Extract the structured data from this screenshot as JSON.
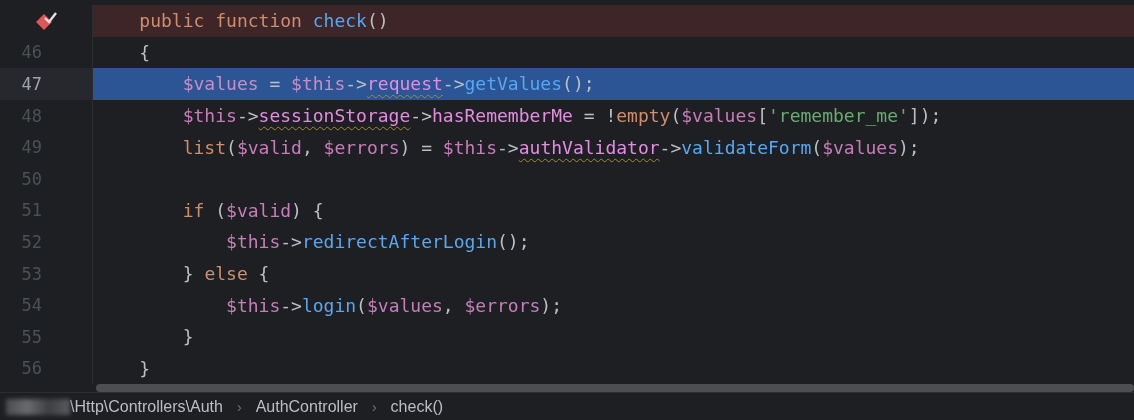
{
  "editor": {
    "lines": [
      {
        "kind": "breakpoint",
        "tokens": [
          {
            "text": "    public function ",
            "kind": "keyword"
          },
          {
            "text": "check",
            "kind": "decl"
          },
          {
            "text": "()",
            "kind": "punct"
          }
        ]
      },
      {
        "number": "46",
        "kind": "plain",
        "tokens": [
          {
            "text": "    {",
            "kind": "punct"
          }
        ]
      },
      {
        "number": "47",
        "kind": "current",
        "tokens": [
          {
            "text": "        $values",
            "kind": "var"
          },
          {
            "text": " = ",
            "kind": "punct"
          },
          {
            "text": "$this",
            "kind": "var"
          },
          {
            "text": "->",
            "kind": "punct"
          },
          {
            "text": "request",
            "kind": "warnfield"
          },
          {
            "text": "->",
            "kind": "punct"
          },
          {
            "text": "getValues",
            "kind": "call"
          },
          {
            "text": "();",
            "kind": "punct"
          }
        ]
      },
      {
        "number": "48",
        "kind": "plain",
        "tokens": [
          {
            "text": "        $this",
            "kind": "var"
          },
          {
            "text": "->",
            "kind": "punct"
          },
          {
            "text": "sessionStorage",
            "kind": "warnfield"
          },
          {
            "text": "->",
            "kind": "punct"
          },
          {
            "text": "hasRememberMe",
            "kind": "field"
          },
          {
            "text": " = !",
            "kind": "punct"
          },
          {
            "text": "empty",
            "kind": "keyword"
          },
          {
            "text": "(",
            "kind": "punct"
          },
          {
            "text": "$values",
            "kind": "var"
          },
          {
            "text": "[",
            "kind": "punct"
          },
          {
            "text": "'remember_me'",
            "kind": "string"
          },
          {
            "text": "]);",
            "kind": "punct"
          }
        ]
      },
      {
        "number": "49",
        "kind": "plain",
        "tokens": [
          {
            "text": "        list",
            "kind": "keyword"
          },
          {
            "text": "(",
            "kind": "punct"
          },
          {
            "text": "$valid",
            "kind": "var"
          },
          {
            "text": ", ",
            "kind": "punct"
          },
          {
            "text": "$errors",
            "kind": "var"
          },
          {
            "text": ") = ",
            "kind": "punct"
          },
          {
            "text": "$this",
            "kind": "var"
          },
          {
            "text": "->",
            "kind": "punct"
          },
          {
            "text": "authValidator",
            "kind": "warnfield"
          },
          {
            "text": "->",
            "kind": "punct"
          },
          {
            "text": "validateForm",
            "kind": "call"
          },
          {
            "text": "(",
            "kind": "punct"
          },
          {
            "text": "$values",
            "kind": "var"
          },
          {
            "text": ");",
            "kind": "punct"
          }
        ]
      },
      {
        "number": "50",
        "kind": "plain"
      },
      {
        "number": "51",
        "kind": "plain",
        "tokens": [
          {
            "text": "        if",
            "kind": "keyword"
          },
          {
            "text": " (",
            "kind": "punct"
          },
          {
            "text": "$valid",
            "kind": "var"
          },
          {
            "text": ") {",
            "kind": "punct"
          }
        ]
      },
      {
        "number": "52",
        "kind": "plain",
        "tokens": [
          {
            "text": "            $this",
            "kind": "var"
          },
          {
            "text": "->",
            "kind": "punct"
          },
          {
            "text": "redirectAfterLogin",
            "kind": "call"
          },
          {
            "text": "();",
            "kind": "punct"
          }
        ]
      },
      {
        "number": "53",
        "kind": "plain",
        "tokens": [
          {
            "text": "        } ",
            "kind": "punct"
          },
          {
            "text": "else",
            "kind": "keyword"
          },
          {
            "text": " {",
            "kind": "punct"
          }
        ]
      },
      {
        "number": "54",
        "kind": "plain",
        "tokens": [
          {
            "text": "            $this",
            "kind": "var"
          },
          {
            "text": "->",
            "kind": "punct"
          },
          {
            "text": "login",
            "kind": "call"
          },
          {
            "text": "(",
            "kind": "punct"
          },
          {
            "text": "$values",
            "kind": "var"
          },
          {
            "text": ", ",
            "kind": "punct"
          },
          {
            "text": "$errors",
            "kind": "var"
          },
          {
            "text": ");",
            "kind": "punct"
          }
        ]
      },
      {
        "number": "55",
        "kind": "plain",
        "tokens": [
          {
            "text": "        }",
            "kind": "punct"
          }
        ]
      },
      {
        "number": "56",
        "kind": "plain",
        "tokens": [
          {
            "text": "    }",
            "kind": "punct"
          }
        ]
      }
    ]
  },
  "breadcrumbs": [
    "\\Http\\Controllers\\Auth",
    "AuthController",
    "check()"
  ],
  "breadcrumb_separator": "›"
}
